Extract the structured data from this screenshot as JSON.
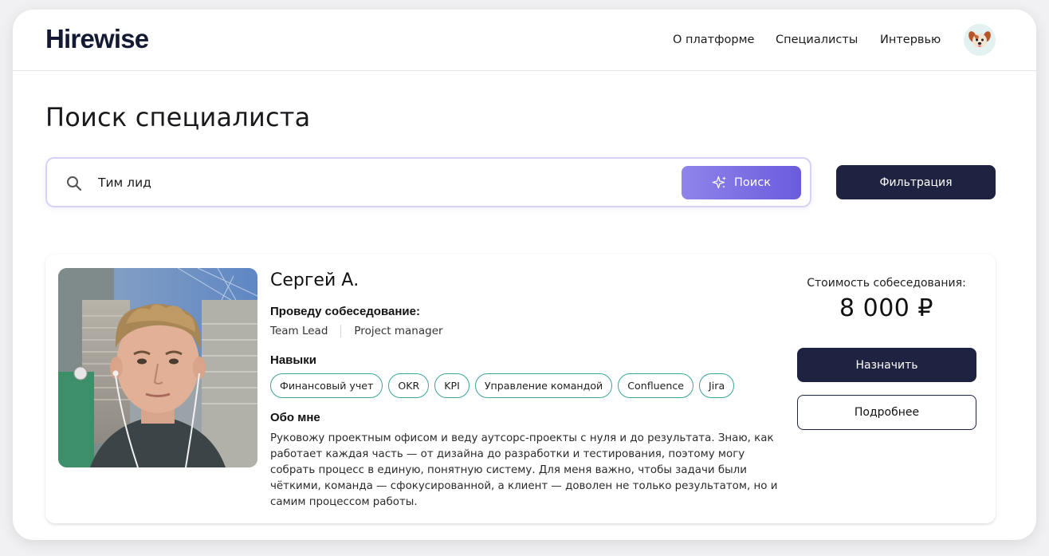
{
  "header": {
    "logo": "Hirewise",
    "nav": [
      {
        "label": "О платформе"
      },
      {
        "label": "Специалисты"
      },
      {
        "label": "Интервью"
      }
    ],
    "avatar_icon": "dog-avatar-icon"
  },
  "page": {
    "title": "Поиск специалиста"
  },
  "search": {
    "value": "Тим лид",
    "button_label": "Поиск",
    "button_icon": "sparkle-icon"
  },
  "filter": {
    "label": "Фильтрация"
  },
  "specialist": {
    "name": "Сергей А.",
    "interview_label": "Проведу собеседование:",
    "roles": [
      "Team Lead",
      "Project manager"
    ],
    "skills_label": "Навыки",
    "skills": [
      "Финансовый учет",
      "OKR",
      "KPI",
      "Управление командой",
      "Confluence",
      "Jira"
    ],
    "about_label": "Обо мне",
    "about": "Руковожу проектным офисом и веду аутсорс-проекты с нуля и до результата. Знаю, как работает каждая часть — от дизайна до разработки и тестирования, поэтому могу собрать процесс в единую, понятную систему. Для меня важно, чтобы задачи были чёткими, команда — сфокусированной, а клиент — доволен не только результатом, но и самим процессом работы.",
    "price_label": "Стоимость собеседования:",
    "price": "8 000 ₽",
    "assign_label": "Назначить",
    "details_label": "Подробнее"
  },
  "colors": {
    "primary_dark": "#1d2340",
    "accent_purple": "#7466e2",
    "tag_border": "#3aa69a"
  }
}
